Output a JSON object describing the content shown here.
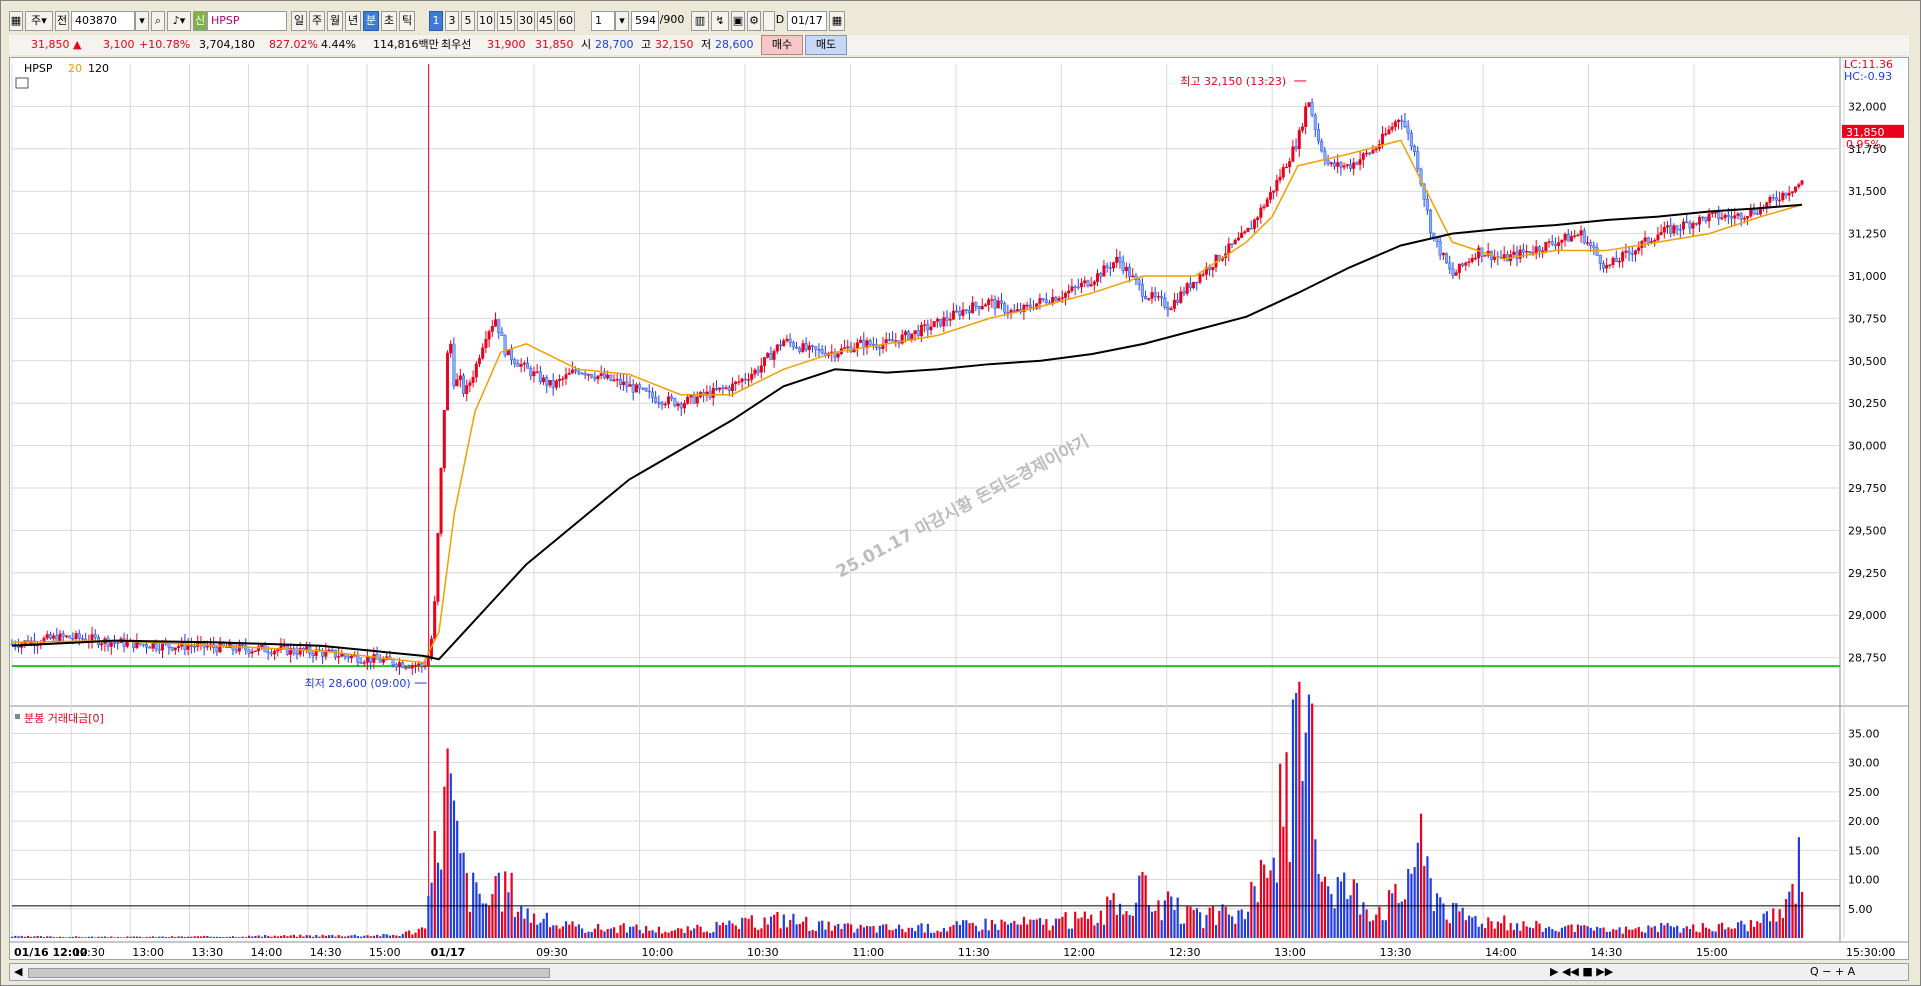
{
  "toolbar": {
    "market_label": "주",
    "prev_label": "전",
    "code": "403870",
    "new_badge": "신",
    "name": "HPSP",
    "period_buttons": [
      "일",
      "주",
      "월",
      "년",
      "분",
      "초",
      "틱"
    ],
    "selected_period": "분",
    "interval_buttons": [
      "1",
      "3",
      "5",
      "10",
      "15",
      "30",
      "45",
      "60"
    ],
    "selected_interval": "1",
    "interval_select": "1",
    "count_value": "594",
    "count_total": "/900",
    "date_prefix": "D",
    "date_value": "01/17"
  },
  "infobar": {
    "price": "31,850",
    "change_arrow": "▲",
    "change": "3,100",
    "change_pct": "+10.78%",
    "volume": "3,704,180",
    "vol_ratio": "827.02%",
    "turnover": "4.44%",
    "amount": "114,816백만",
    "best_label": "최우선",
    "best_ask": "31,900",
    "best_bid": "31,850",
    "open_label": "시",
    "open": "28,700",
    "high_label": "고",
    "high": "32,150",
    "low_label": "저",
    "low": "28,600",
    "buy_label": "매수",
    "sell_label": "매도"
  },
  "colors": {
    "up": "#e8001c",
    "down": "#1f3de0",
    "ma20": "#f0a000",
    "ma120": "#000000",
    "support": "#22c322",
    "grid": "#d9d9d9"
  },
  "chart_data": [
    {
      "type": "candlestick",
      "title": "HPSP",
      "legend": [
        {
          "name": "20",
          "color": "#f0a000"
        },
        {
          "name": "120",
          "color": "#000000"
        }
      ],
      "right_labels": {
        "lc": "LC:11.36",
        "hc": "HC:-0.93",
        "last_price": "31,850",
        "last_pct": "0.95%"
      },
      "y_ticks": [
        "32,000",
        "31,750",
        "31,500",
        "31,250",
        "31,000",
        "30,750",
        "30,500",
        "30,250",
        "30,000",
        "29,750",
        "29,500",
        "29,250",
        "29,000",
        "28,750"
      ],
      "ylim": [
        28,
        500,
        32,
        250
      ],
      "x_ticks": [
        "01/16 12:00",
        "12:30",
        "13:00",
        "13:30",
        "14:00",
        "14:30",
        "15:00",
        "01/17",
        "09:30",
        "10:00",
        "10:30",
        "11:00",
        "11:30",
        "12:00",
        "12:30",
        "13:00",
        "13:30",
        "14:00",
        "14:30",
        "15:00",
        "15:30:00"
      ],
      "high_annotation": "최고 32,150 (13:23)",
      "low_annotation": "최저 28,600 (09:00)",
      "watermark": "25.01.17 마감시황 돈되는경제이야기",
      "support_level": 28700,
      "price_path": [
        [
          0,
          28830
        ],
        [
          0.5,
          28850
        ],
        [
          1,
          28870
        ],
        [
          1.5,
          28860
        ],
        [
          2,
          28840
        ],
        [
          2.5,
          28830
        ],
        [
          3,
          28820
        ],
        [
          3.5,
          28820
        ],
        [
          4,
          28810
        ],
        [
          4.5,
          28800
        ],
        [
          5,
          28800
        ],
        [
          5.5,
          28790
        ],
        [
          6,
          28780
        ],
        [
          6.5,
          28760
        ],
        [
          7,
          28740
        ],
        [
          7.5,
          28720
        ],
        [
          8,
          28700
        ],
        [
          8.1,
          28750
        ],
        [
          8.2,
          28950
        ],
        [
          8.3,
          29600
        ],
        [
          8.4,
          30200
        ],
        [
          8.5,
          30700
        ],
        [
          8.6,
          30350
        ],
        [
          8.7,
          30400
        ],
        [
          8.8,
          30300
        ],
        [
          9,
          30450
        ],
        [
          9.2,
          30650
        ],
        [
          9.4,
          30750
        ],
        [
          9.6,
          30550
        ],
        [
          10,
          30450
        ],
        [
          10.5,
          30350
        ],
        [
          11,
          30450
        ],
        [
          11.5,
          30400
        ],
        [
          12,
          30350
        ],
        [
          12.5,
          30280
        ],
        [
          13,
          30250
        ],
        [
          13.5,
          30300
        ],
        [
          14,
          30350
        ],
        [
          14.5,
          30450
        ],
        [
          15,
          30620
        ],
        [
          15.5,
          30560
        ],
        [
          16,
          30550
        ],
        [
          16.5,
          30600
        ],
        [
          17,
          30600
        ],
        [
          17.5,
          30660
        ],
        [
          18,
          30720
        ],
        [
          18.5,
          30800
        ],
        [
          19,
          30850
        ],
        [
          19.5,
          30780
        ],
        [
          20,
          30850
        ],
        [
          20.5,
          30900
        ],
        [
          21,
          30980
        ],
        [
          21.5,
          31100
        ],
        [
          22,
          30900
        ],
        [
          22.5,
          30820
        ],
        [
          23,
          30980
        ],
        [
          23.5,
          31120
        ],
        [
          24,
          31250
        ],
        [
          24.5,
          31500
        ],
        [
          25,
          31800
        ],
        [
          25.2,
          32050
        ],
        [
          25.4,
          31800
        ],
        [
          25.6,
          31650
        ],
        [
          26,
          31650
        ],
        [
          26.5,
          31750
        ],
        [
          27,
          31950
        ],
        [
          27.3,
          31700
        ],
        [
          27.6,
          31250
        ],
        [
          28,
          31000
        ],
        [
          28.5,
          31150
        ],
        [
          29,
          31100
        ],
        [
          29.5,
          31150
        ],
        [
          30,
          31200
        ],
        [
          30.5,
          31250
        ],
        [
          31,
          31050
        ],
        [
          31.5,
          31150
        ],
        [
          32,
          31250
        ],
        [
          32.5,
          31300
        ],
        [
          33,
          31350
        ],
        [
          33.5,
          31350
        ],
        [
          34,
          31400
        ],
        [
          34.5,
          31500
        ],
        [
          34.8,
          31550
        ]
      ],
      "ma20_path": [
        [
          0,
          28840
        ],
        [
          2,
          28850
        ],
        [
          4,
          28820
        ],
        [
          6,
          28790
        ],
        [
          8,
          28720
        ],
        [
          8.3,
          28900
        ],
        [
          8.6,
          29600
        ],
        [
          9,
          30200
        ],
        [
          9.5,
          30550
        ],
        [
          10,
          30600
        ],
        [
          11,
          30450
        ],
        [
          12,
          30420
        ],
        [
          13,
          30300
        ],
        [
          14,
          30300
        ],
        [
          15,
          30450
        ],
        [
          16,
          30550
        ],
        [
          17,
          30600
        ],
        [
          18,
          30650
        ],
        [
          19,
          30750
        ],
        [
          20,
          30820
        ],
        [
          21,
          30900
        ],
        [
          22,
          31000
        ],
        [
          23,
          31000
        ],
        [
          24,
          31200
        ],
        [
          24.5,
          31350
        ],
        [
          25,
          31650
        ],
        [
          26,
          31720
        ],
        [
          27,
          31800
        ],
        [
          27.5,
          31500
        ],
        [
          28,
          31200
        ],
        [
          29,
          31100
        ],
        [
          30,
          31150
        ],
        [
          31,
          31150
        ],
        [
          32,
          31200
        ],
        [
          33,
          31250
        ],
        [
          34,
          31350
        ],
        [
          34.8,
          31420
        ]
      ],
      "ma120_path": [
        [
          0,
          28820
        ],
        [
          2,
          28850
        ],
        [
          4,
          28840
        ],
        [
          6,
          28820
        ],
        [
          8,
          28760
        ],
        [
          8.3,
          28740
        ],
        [
          10,
          29300
        ],
        [
          12,
          29800
        ],
        [
          14,
          30150
        ],
        [
          15,
          30350
        ],
        [
          16,
          30450
        ],
        [
          17,
          30430
        ],
        [
          18,
          30450
        ],
        [
          19,
          30480
        ],
        [
          20,
          30500
        ],
        [
          21,
          30540
        ],
        [
          22,
          30600
        ],
        [
          23,
          30680
        ],
        [
          24,
          30760
        ],
        [
          25,
          30900
        ],
        [
          26,
          31050
        ],
        [
          27,
          31180
        ],
        [
          28,
          31250
        ],
        [
          29,
          31280
        ],
        [
          30,
          31300
        ],
        [
          31,
          31330
        ],
        [
          32,
          31350
        ],
        [
          33,
          31380
        ],
        [
          34,
          31400
        ],
        [
          34.8,
          31420
        ]
      ]
    },
    {
      "type": "bar",
      "title": "분봉 거래대금[0]",
      "y_ticks": [
        "35.00",
        "30.00",
        "25.00",
        "20.00",
        "15.00",
        "10.00",
        "5.00"
      ],
      "ylim": [
        0,
        39
      ],
      "reference_line": 5.5,
      "volume_path": [
        [
          0,
          0.3
        ],
        [
          2,
          0.2
        ],
        [
          4,
          0.3
        ],
        [
          6,
          0.5
        ],
        [
          7.5,
          0.6
        ],
        [
          8,
          2.0
        ],
        [
          8.1,
          6
        ],
        [
          8.2,
          15
        ],
        [
          8.3,
          23
        ],
        [
          8.4,
          28
        ],
        [
          8.5,
          33
        ],
        [
          8.6,
          20
        ],
        [
          8.7,
          18
        ],
        [
          8.8,
          12
        ],
        [
          9,
          9
        ],
        [
          9.3,
          7
        ],
        [
          9.6,
          11
        ],
        [
          10,
          5
        ],
        [
          10.5,
          3
        ],
        [
          11,
          2
        ],
        [
          12,
          2
        ],
        [
          13,
          1.5
        ],
        [
          14,
          2.5
        ],
        [
          15,
          4
        ],
        [
          16,
          2
        ],
        [
          17,
          2
        ],
        [
          18,
          2
        ],
        [
          19,
          3
        ],
        [
          20,
          3
        ],
        [
          21,
          4
        ],
        [
          22,
          9
        ],
        [
          22.5,
          6
        ],
        [
          23,
          4
        ],
        [
          24,
          5
        ],
        [
          24.5,
          18
        ],
        [
          25,
          37
        ],
        [
          25.2,
          38
        ],
        [
          25.4,
          19
        ],
        [
          25.6,
          12
        ],
        [
          26,
          10
        ],
        [
          26.5,
          6
        ],
        [
          27,
          8
        ],
        [
          27.3,
          20
        ],
        [
          27.6,
          11
        ],
        [
          28,
          5
        ],
        [
          29,
          3
        ],
        [
          30,
          2
        ],
        [
          31,
          1.5
        ],
        [
          32,
          2
        ],
        [
          33,
          2
        ],
        [
          34,
          3
        ],
        [
          34.5,
          6
        ],
        [
          34.8,
          18
        ]
      ]
    }
  ],
  "statusbar": {
    "left_arrow": "◀",
    "right_controls": "▶ ◀◀ ■ ▶▶",
    "zoom": "Q − + A"
  }
}
